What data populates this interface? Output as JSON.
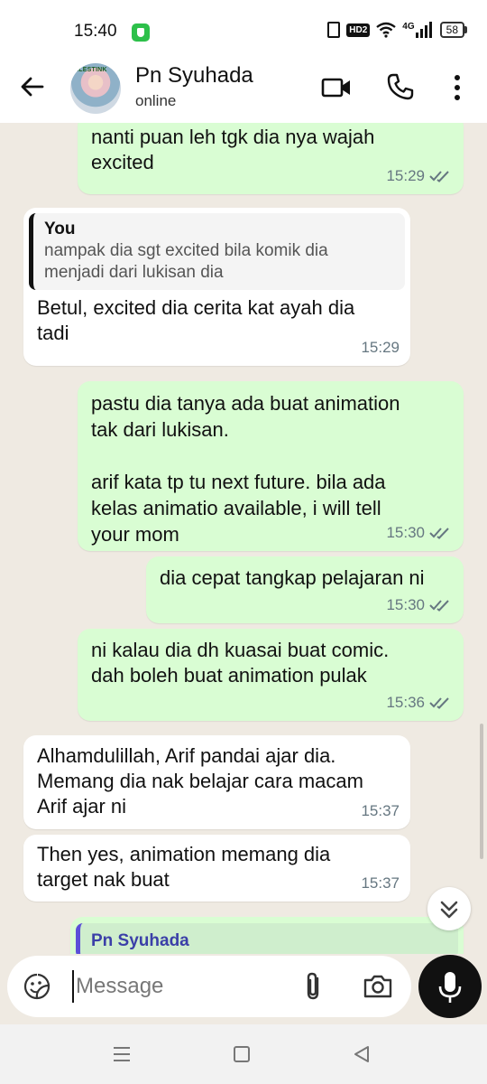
{
  "status_bar": {
    "time": "15:40",
    "network": "4G",
    "hd_label": "HD2",
    "battery": "58"
  },
  "header": {
    "contact_name": "Pn Syuhada",
    "contact_status": "online",
    "avatar_text": "KLESTINK"
  },
  "messages": [
    {
      "direction": "out",
      "text": "nanti puan leh tgk dia nya wajah\nexcited",
      "time": "15:29",
      "read": true
    },
    {
      "direction": "in",
      "quote": {
        "author": "You",
        "text": "nampak dia sgt excited bila komik dia\nmenjadi dari lukisan dia"
      },
      "text": "Betul, excited dia cerita kat ayah dia\ntadi",
      "time": "15:29"
    },
    {
      "direction": "out",
      "text": "pastu dia tanya ada buat animation\ntak dari lukisan.\n\narif kata tp tu next future. bila ada\nkelas animatio available, i will tell\nyour mom",
      "time": "15:30",
      "read": true
    },
    {
      "direction": "out",
      "text": "dia cepat tangkap pelajaran ni",
      "time": "15:30",
      "read": true
    },
    {
      "direction": "out",
      "text": "ni kalau dia dh kuasai buat comic.\ndah boleh buat animation pulak",
      "time": "15:36",
      "read": true
    },
    {
      "direction": "in",
      "text": "Alhamdulillah, Arif pandai ajar dia.\nMemang dia nak belajar cara macam\nArif ajar ni",
      "time": "15:37"
    },
    {
      "direction": "in",
      "text": "Then yes, animation memang dia\ntarget nak buat",
      "time": "15:37"
    },
    {
      "direction": "out",
      "quote": {
        "author": "Pn Syuhada"
      }
    }
  ],
  "composer": {
    "placeholder": "Message"
  },
  "colors": {
    "outgoing_bubble": "#d9fdd3",
    "incoming_bubble": "#ffffff",
    "chat_background": "#efeae2",
    "read_tick": "#667781"
  }
}
